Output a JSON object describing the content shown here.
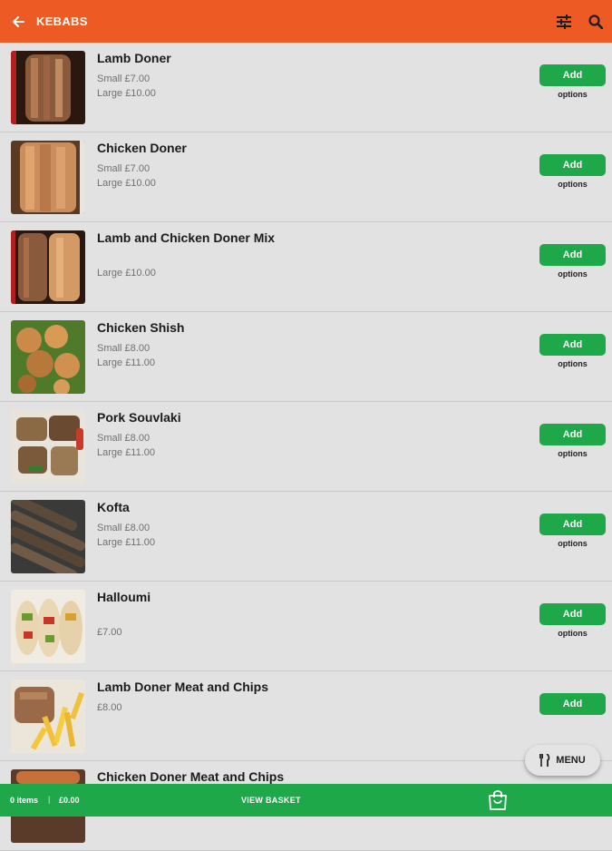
{
  "header": {
    "title": "KEBABS",
    "back_icon": "arrow-left-icon",
    "filter_icon": "sliders-icon",
    "search_icon": "search-icon"
  },
  "colors": {
    "header": "#ee5a23",
    "accent_green": "#1ea84a",
    "background": "#e2e2e2"
  },
  "items": [
    {
      "name": "Lamb Doner",
      "price1": "Small £7.00",
      "price2": "Large £10.00",
      "add": "Add",
      "options": "options",
      "image": "lamb-doner-photo"
    },
    {
      "name": "Chicken Doner",
      "price1": "Small £7.00",
      "price2": "Large £10.00",
      "add": "Add",
      "options": "options",
      "image": "chicken-doner-photo"
    },
    {
      "name": "Lamb and Chicken Doner Mix",
      "price1": "",
      "price2": "Large £10.00",
      "add": "Add",
      "options": "options",
      "image": "doner-mix-photo"
    },
    {
      "name": "Chicken Shish",
      "price1": "Small £8.00",
      "price2": "Large £11.00",
      "add": "Add",
      "options": "options",
      "image": "chicken-shish-photo"
    },
    {
      "name": "Pork Souvlaki",
      "price1": "Small £8.00",
      "price2": "Large £11.00",
      "add": "Add",
      "options": "options",
      "image": "pork-souvlaki-photo"
    },
    {
      "name": "Kofta",
      "price1": "Small £8.00",
      "price2": "Large £11.00",
      "add": "Add",
      "options": "options",
      "image": "kofta-photo"
    },
    {
      "name": "Halloumi",
      "price1": "",
      "price2": "£7.00",
      "add": "Add",
      "options": "options",
      "image": "halloumi-photo"
    },
    {
      "name": "Lamb Doner Meat and Chips",
      "price1": "£8.00",
      "price2": "",
      "add": "Add",
      "options": "",
      "image": "lamb-chips-photo"
    },
    {
      "name": "Chicken Doner Meat and Chips",
      "price1": "",
      "price2": "",
      "add": "",
      "options": "",
      "image": "chicken-chips-photo"
    }
  ],
  "menu_button": {
    "label": "MENU",
    "icon": "cutlery-icon"
  },
  "basket": {
    "items": "0 items",
    "separator": "|",
    "total": "£0.00",
    "view_label": "VIEW BASKET",
    "bag_icon": "shopping-bag-icon"
  }
}
